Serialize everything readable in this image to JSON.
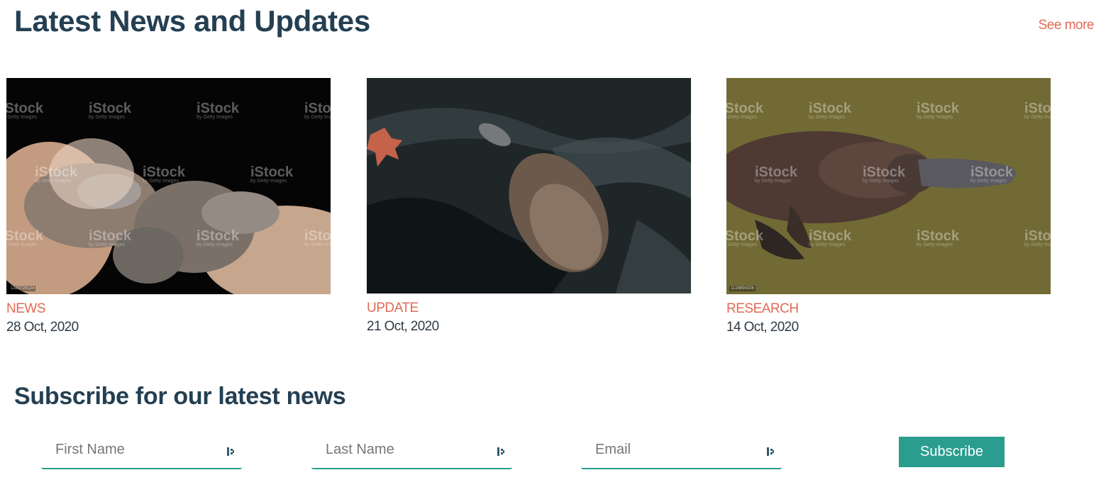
{
  "news": {
    "title": "Latest News and Updates",
    "see_more": "See more",
    "cards": [
      {
        "category": "NEWS",
        "date": "28 Oct, 2020",
        "image": "platypus-babies-in-hands",
        "stock_id": "1320729124"
      },
      {
        "category": "UPDATE",
        "date": "21 Oct, 2020",
        "image": "platypus-swimming-dark-water",
        "stock_id": ""
      },
      {
        "category": "RESEARCH",
        "date": "14 Oct, 2020",
        "image": "platypus-swimming-green-water",
        "stock_id": "1128894336"
      }
    ],
    "watermark": {
      "brand": "iStock",
      "sub": "by Getty Images"
    }
  },
  "subscribe": {
    "title": "Subscribe for our latest news",
    "first_name_placeholder": "First Name",
    "last_name_placeholder": "Last Name",
    "email_placeholder": "Email",
    "button_label": "Subscribe",
    "field_icon": "password-key-icon"
  },
  "colors": {
    "heading": "#243f52",
    "accent": "#e06a55",
    "teal": "#2a9d8f"
  }
}
